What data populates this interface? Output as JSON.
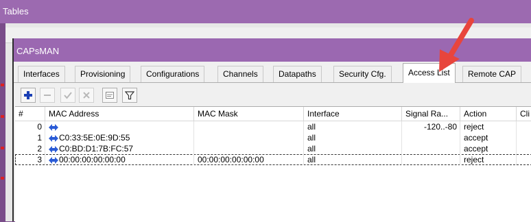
{
  "background_window": {
    "title": "Tables",
    "accent": "#9c6ab0"
  },
  "capsman": {
    "title": "CAPsMAN",
    "tabs": [
      {
        "label": "Interfaces"
      },
      {
        "label": "Provisioning"
      },
      {
        "label": "Configurations"
      },
      {
        "label": "Channels"
      },
      {
        "label": "Datapaths"
      },
      {
        "label": "Security Cfg."
      },
      {
        "label": "Access List",
        "active": true
      },
      {
        "label": "Remote CAP"
      }
    ],
    "toolbar": {
      "icons": [
        "plus-icon",
        "minus-icon",
        "check-icon",
        "cross-icon",
        "comment-icon",
        "filter-icon"
      ]
    },
    "table": {
      "columns": [
        "#",
        "MAC Address",
        "MAC Mask",
        "Interface",
        "Signal Ra...",
        "Action",
        "Cli"
      ],
      "rows": [
        {
          "num": "0",
          "mac": "",
          "mask": "",
          "interface": "all",
          "signal": "-120..-80",
          "action": "reject"
        },
        {
          "num": "1",
          "mac": "C0:33:5E:0E:9D:55",
          "mask": "",
          "interface": "all",
          "signal": "",
          "action": "accept"
        },
        {
          "num": "2",
          "mac": "C0:BD:D1:7B:FC:57",
          "mask": "",
          "interface": "all",
          "signal": "",
          "action": "accept"
        },
        {
          "num": "3",
          "mac": "00:00:00:00:00:00",
          "mask": "00:00:00:00:00:00",
          "interface": "all",
          "signal": "",
          "action": "reject",
          "selected": true
        }
      ]
    },
    "colors": {
      "titlebar": "#9b68b1",
      "plus": "#1a3fb5",
      "arrow": "#e8453c",
      "mac_icon": "#2a5bd6"
    }
  }
}
